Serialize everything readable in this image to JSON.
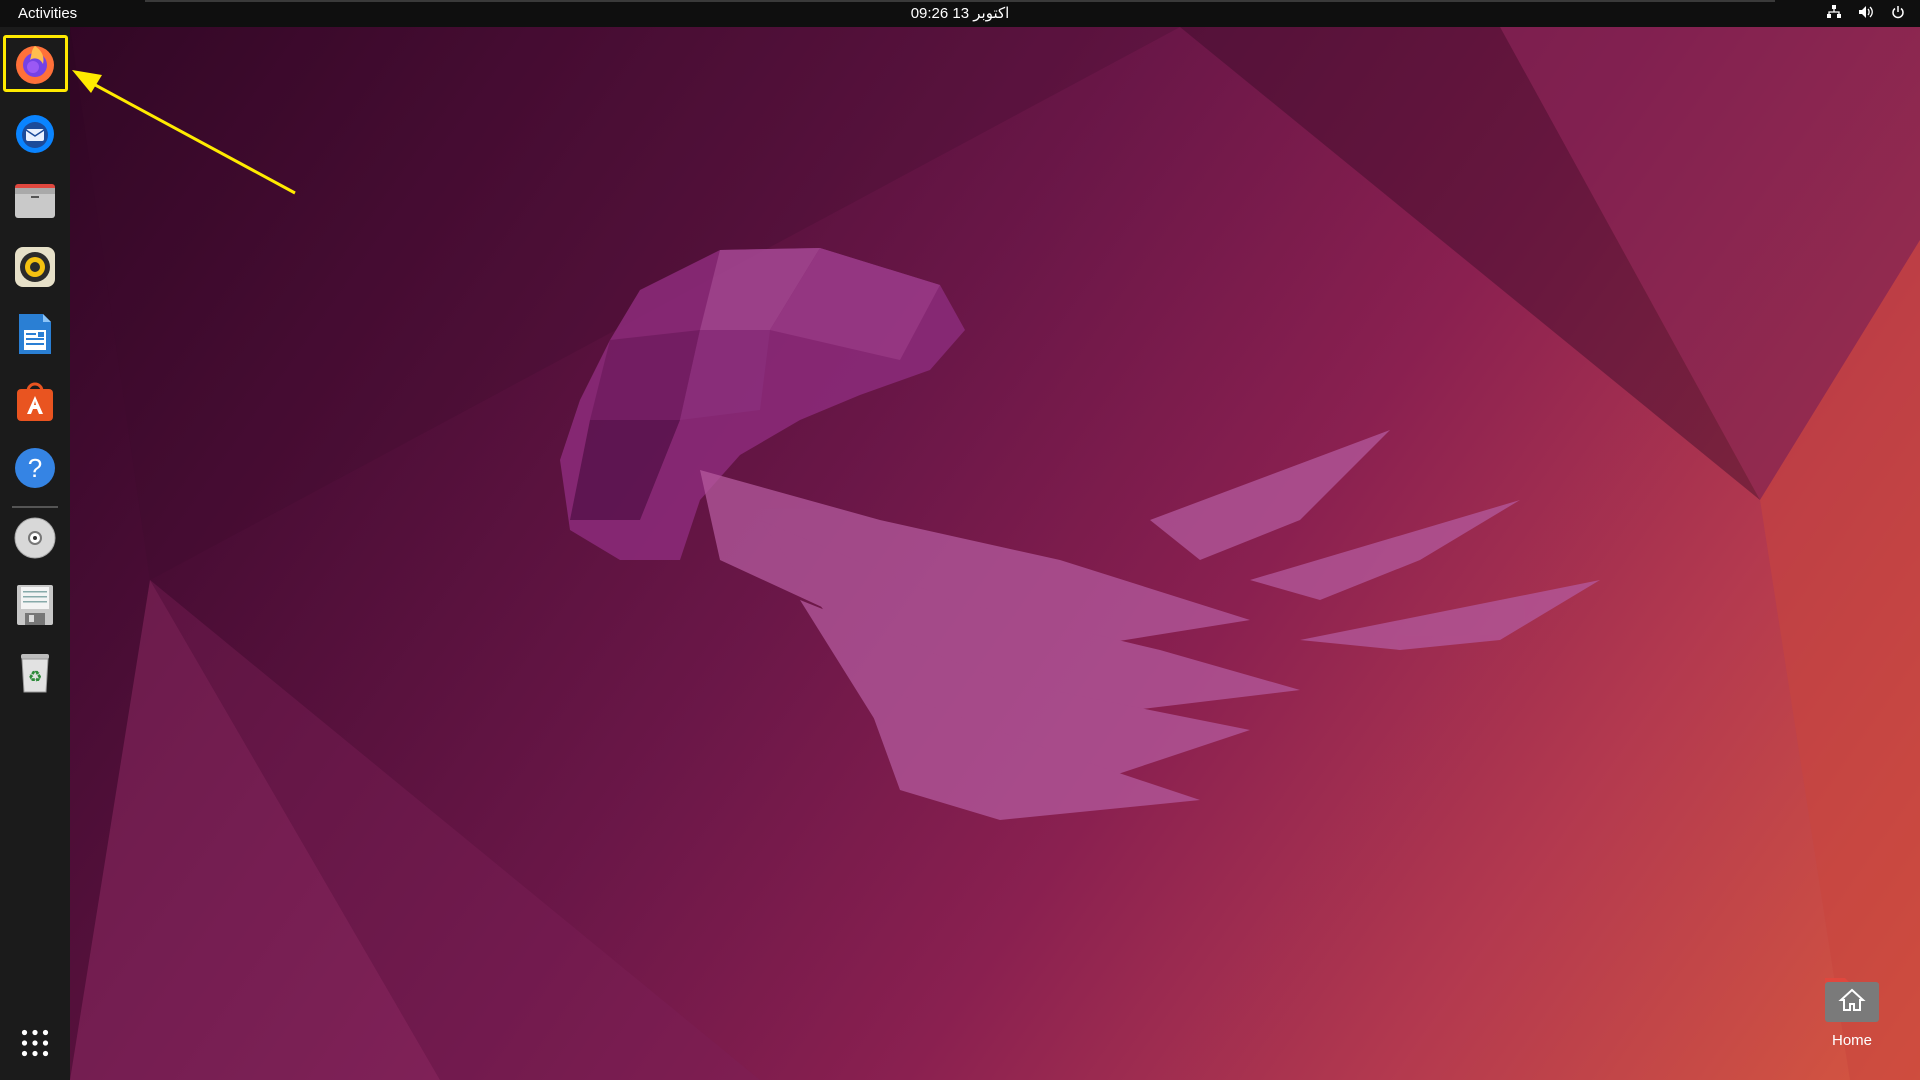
{
  "topbar": {
    "activities_label": "Activities",
    "clock_text": "09:26 13 اکتوبر",
    "tray_icons": [
      "network-icon",
      "volume-icon",
      "power-icon"
    ]
  },
  "dock": {
    "items": [
      {
        "name": "firefox",
        "icon": "firefox-icon",
        "highlighted": true
      },
      {
        "name": "thunderbird",
        "icon": "thunderbird-icon"
      },
      {
        "name": "files",
        "icon": "files-icon"
      },
      {
        "name": "rhythmbox",
        "icon": "rhythmbox-icon"
      },
      {
        "name": "libreoffice-writer",
        "icon": "writer-icon"
      },
      {
        "name": "ubuntu-software",
        "icon": "software-icon"
      },
      {
        "name": "help",
        "icon": "help-icon"
      },
      {
        "name": "disc",
        "icon": "disc-icon"
      },
      {
        "name": "floppy-drive",
        "icon": "floppy-icon"
      },
      {
        "name": "trash",
        "icon": "trash-icon"
      }
    ],
    "show_apps_icon": "grid-icon"
  },
  "desktop": {
    "home_label": "Home"
  },
  "colors": {
    "highlight": "#ffeb00",
    "topbar": "#0f0f0f",
    "dock": "#1b1b1b"
  }
}
